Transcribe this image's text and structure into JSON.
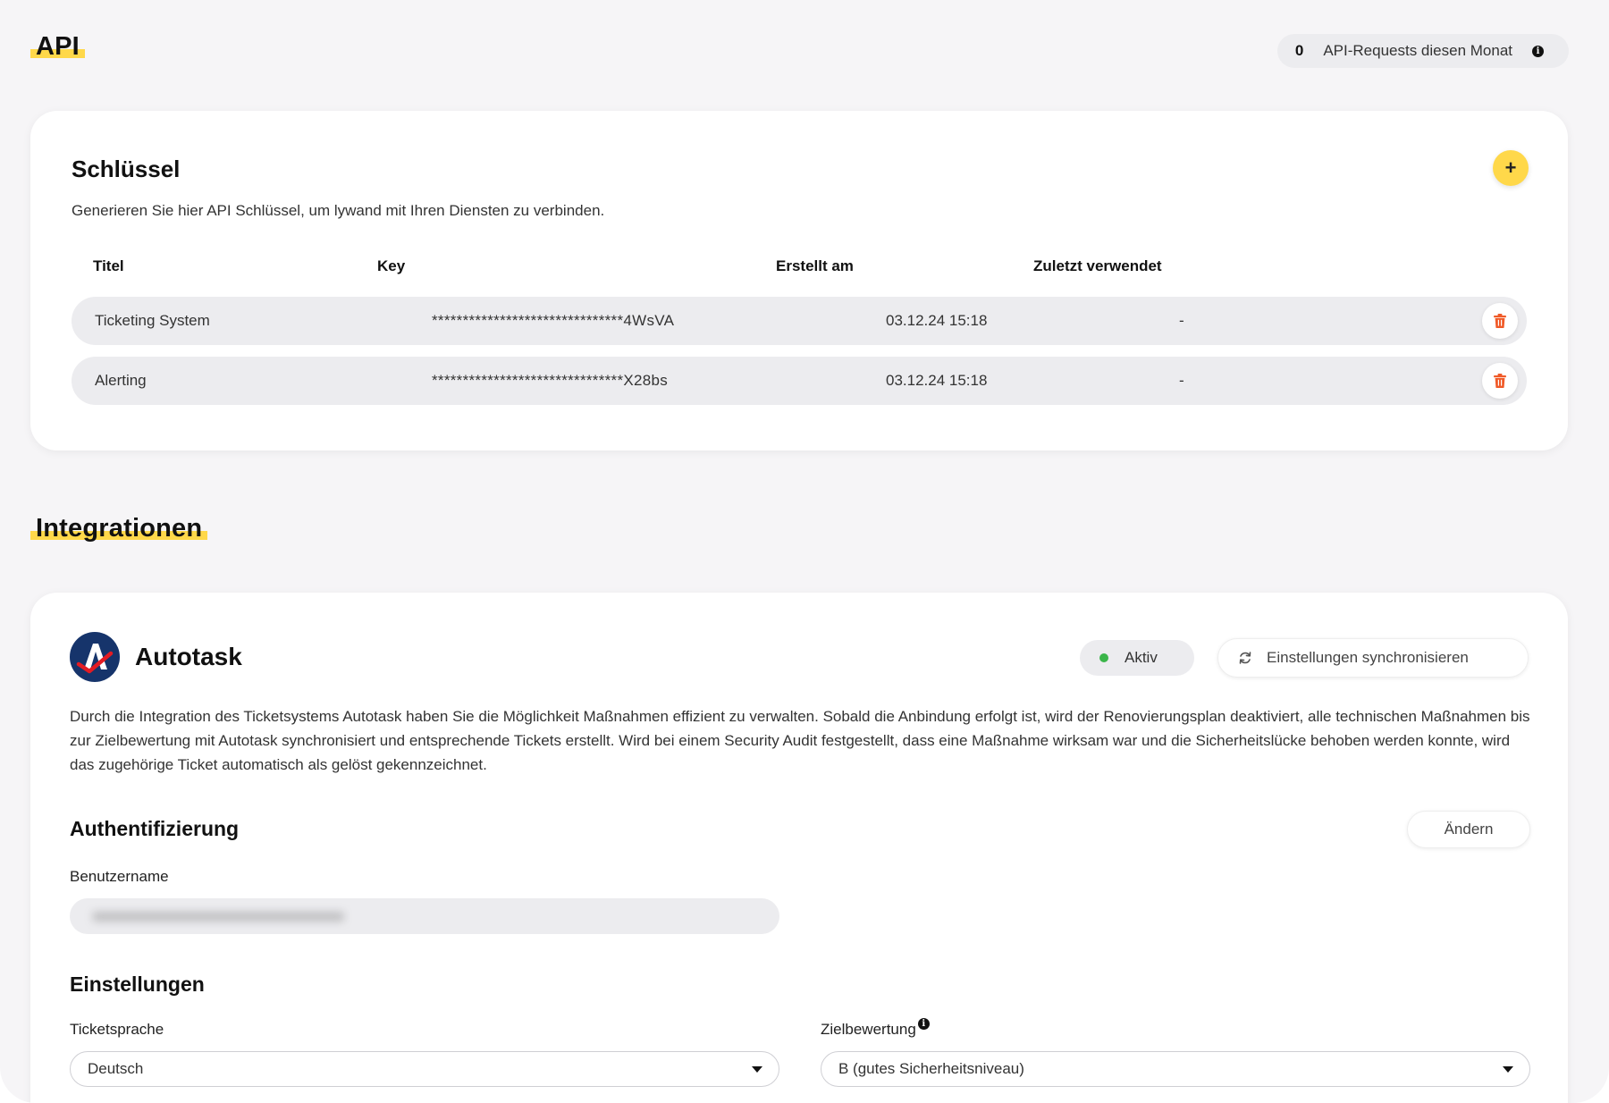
{
  "api_section": {
    "title": "API",
    "request_count": "0",
    "request_label": "API-Requests diesen Monat"
  },
  "keys": {
    "heading": "Schlüssel",
    "description": "Generieren Sie hier API Schlüssel, um lywand mit Ihren Diensten zu verbinden.",
    "columns": [
      "Titel",
      "Key",
      "Erstellt am",
      "Zuletzt verwendet"
    ],
    "rows": [
      {
        "title": "Ticketing System",
        "key": "*******************************4WsVA",
        "created": "03.12.24 15:18",
        "last_used": "-"
      },
      {
        "title": "Alerting",
        "key": "*******************************X28bs",
        "created": "03.12.24 15:18",
        "last_used": "-"
      }
    ]
  },
  "integrations": {
    "title": "Integrationen",
    "autotask": {
      "name": "Autotask",
      "status": "Aktiv",
      "sync_label": "Einstellungen synchronisieren",
      "description": "Durch die Integration des Ticketsystems Autotask haben Sie die Möglichkeit Maßnahmen effizient zu verwalten. Sobald die Anbindung erfolgt ist, wird der Renovierungsplan deaktiviert, alle technischen Maßnahmen bis zur Zielbewertung mit Autotask synchronisiert und entsprechende Tickets erstellt. Wird bei einem Security Audit festgestellt, dass eine Maßnahme wirksam war und die Sicherheitslücke behoben werden konnte, wird das zugehörige Ticket automatisch als gelöst gekennzeichnet.",
      "auth_heading": "Authentifizierung",
      "change_label": "Ändern",
      "username_label": "Benutzername",
      "settings_heading": "Einstellungen",
      "language_label": "Ticketsprache",
      "language_value": "Deutsch",
      "target_label": "Zielbewertung",
      "target_value": "B (gutes Sicherheitsniveau)"
    }
  },
  "colors": {
    "accent": "#ffd84a",
    "status_active": "#3bb54a",
    "delete": "#f05a28",
    "logo_bg": "#16346b"
  },
  "icons": [
    "info-icon",
    "plus-icon",
    "trash-icon",
    "sync-icon",
    "chevron-down-icon",
    "autotask-logo"
  ]
}
